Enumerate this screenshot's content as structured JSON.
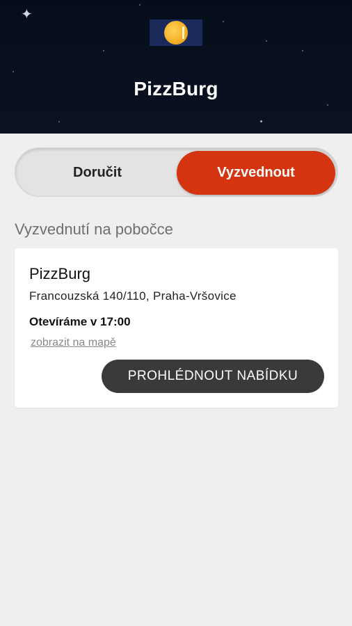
{
  "header": {
    "brand_name": "PizzBurg",
    "logo_icon": "pizzburg-logo-icon",
    "background_color": "#0a1222"
  },
  "order_mode": {
    "options": [
      {
        "label": "Doručit",
        "selected": false
      },
      {
        "label": "Vyzvednout",
        "selected": true
      }
    ],
    "accent_color": "#d43410"
  },
  "section": {
    "title": "Vyzvednutí na pobočce"
  },
  "branch": {
    "name": "PizzBurg",
    "address": "Francouzská 140/110, Praha-Vršovice",
    "opening": "Otevíráme v 17:00",
    "map_link": "zobrazit na mapě",
    "menu_button": "PROHLÉDNOUT NABÍDKU"
  }
}
